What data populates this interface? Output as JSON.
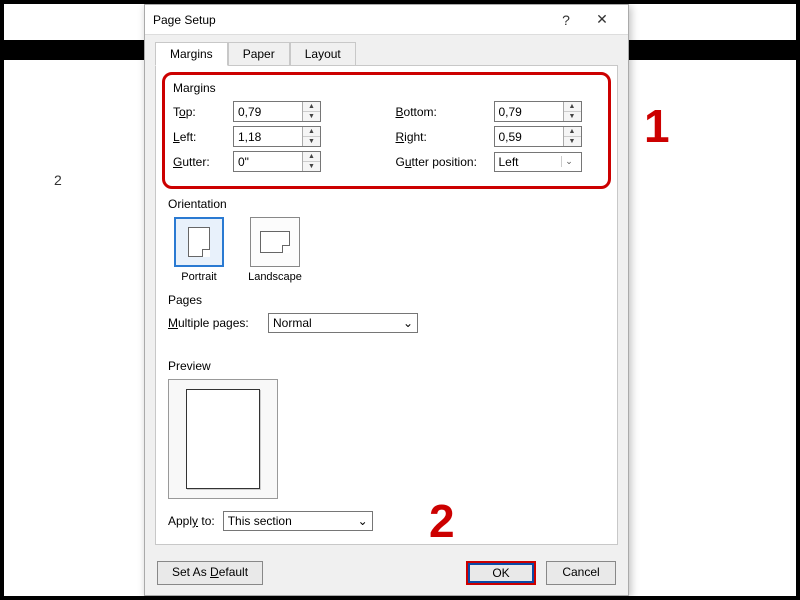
{
  "bg": {
    "page_num": "2"
  },
  "dialog": {
    "title": "Page Setup",
    "tabs": {
      "margins": "Margins",
      "paper": "Paper",
      "layout": "Layout"
    },
    "margins": {
      "group": "Margins",
      "top_label_pre": "T",
      "top_label_u": "o",
      "top_label_post": "p:",
      "top": "0,79",
      "bottom_label_pre": "",
      "bottom_label_u": "B",
      "bottom_label_post": "ottom:",
      "bottom": "0,79",
      "left_label_pre": "",
      "left_label_u": "L",
      "left_label_post": "eft:",
      "left": "1,18",
      "right_label_pre": "",
      "right_label_u": "R",
      "right_label_post": "ight:",
      "right": "0,59",
      "gutter_label_pre": "",
      "gutter_label_u": "G",
      "gutter_label_post": "utter:",
      "gutter": "0\"",
      "gutterpos_label_pre": "G",
      "gutterpos_label_u": "u",
      "gutterpos_label_post": "tter position:",
      "gutterpos": "Left"
    },
    "orientation": {
      "group": "Orientation",
      "portrait": "Portrait",
      "landscape": "Landscape"
    },
    "pages": {
      "group": "Pages",
      "mp_label_pre": "",
      "mp_label_u": "M",
      "mp_label_post": "ultiple pages:",
      "mp_value": "Normal"
    },
    "preview": {
      "group": "Preview"
    },
    "apply": {
      "label_pre": "Appl",
      "label_u": "y",
      "label_post": " to:",
      "value": "This section"
    },
    "buttons": {
      "default_pre": "Set As ",
      "default_u": "D",
      "default_post": "efault",
      "ok": "OK",
      "cancel": "Cancel"
    }
  },
  "annotations": {
    "one": "1",
    "two": "2"
  }
}
